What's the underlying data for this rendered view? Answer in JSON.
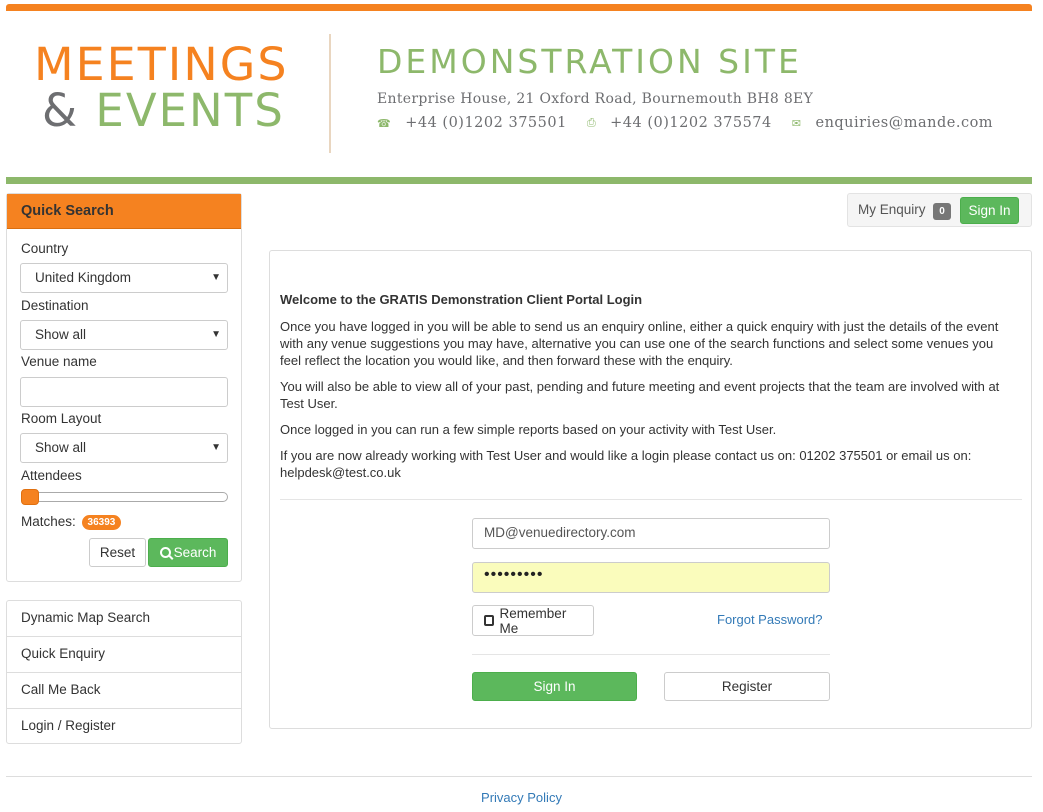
{
  "header": {
    "logo_line1": "MEETINGS",
    "logo_amp": "&",
    "logo_line2": "EVENTS",
    "site_title": "DEMONSTRATION SITE",
    "address": "Enterprise House, 21 Oxford Road, Bournemouth BH8 8EY",
    "phone": "+44 (0)1202 375501",
    "fax": "+44 (0)1202 375574",
    "email": "enquiries@mande.com",
    "phone_icon": "☎",
    "fax_icon": "⎙",
    "email_icon": "✉"
  },
  "quick_search": {
    "title": "Quick Search",
    "country_label": "Country",
    "country_value": "United Kingdom",
    "destination_label": "Destination",
    "destination_value": "Show all",
    "venue_label": "Venue name",
    "venue_value": "",
    "room_layout_label": "Room Layout",
    "room_layout_value": "Show all",
    "attendees_label": "Attendees",
    "attendees_level": 0,
    "matches_label": "Matches:",
    "matches_count": "36393",
    "reset_label": "Reset",
    "search_label": "Search",
    "search_icon": "🔍"
  },
  "nav": {
    "items": [
      {
        "label": "Dynamic Map Search"
      },
      {
        "label": "Quick Enquiry"
      },
      {
        "label": "Call Me Back"
      },
      {
        "label": "Login / Register"
      }
    ]
  },
  "top_right": {
    "my_enquiry_label": "My Enquiry",
    "enquiry_count": "0",
    "sign_in_label": "Sign In"
  },
  "main": {
    "welcome_title": "Welcome to the GRATIS Demonstration Client Portal Login",
    "para1": "Once you have logged in you will be able to send us an enquiry online, either a quick enquiry with just the details of the event with any venue suggestions you may have, alternative you can use one of the search functions and select some venues you feel reflect the location you would like, and then forward these with the enquiry.",
    "para2": "You will also be able to view all of your past, pending and future meeting and event projects that the team are involved with at Test User.",
    "para3": "Once logged in you can run a few simple reports based on your activity with Test User.",
    "para4": "If you are now already working with Test User and would like a login please contact us on: 01202 375501 or email us on: helpdesk@test.co.uk"
  },
  "login": {
    "email_value": "MD@venuedirectory.com",
    "password_value": "•••••••••",
    "remember_label": "Remember Me",
    "forgot_label": "Forgot Password?",
    "sign_in_label": "Sign In",
    "register_label": "Register"
  },
  "footer": {
    "privacy_label": "Privacy Policy"
  },
  "colors": {
    "brand_orange": "#f58220",
    "brand_green": "#8db86b",
    "button_green": "#5cb85c",
    "link_blue": "#337ab7"
  }
}
